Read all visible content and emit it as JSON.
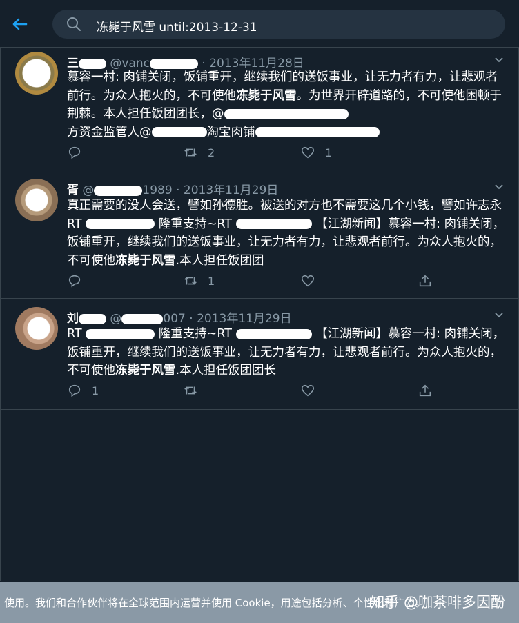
{
  "search": {
    "query": "冻毙于风雪 until:2013-12-31"
  },
  "tweets": [
    {
      "name": "三",
      "handle": "@vanc",
      "date": "· 2013年11月28日",
      "text_1": "慕容一村: 肉铺关闭，饭铺重开，继续我们的送饭事业，让无力者有力，让悲观者前行。为众人抱火的，不可使他",
      "text_bold": "冻毙于风雪",
      "text_2": "。为世界开辟道路的，不可使他困顿于荆棘。本人担任饭团团长，@",
      "text_3": "方资金监管人@",
      "text_4": "淘宝肉铺",
      "reply_count": "",
      "retweet_count": "2",
      "like_count": "1"
    },
    {
      "name": "胥",
      "handle": "@",
      "handle_tail": "1989",
      "date": "· 2013年11月29日",
      "line_1": "真正需要的没人会送，譬如孙德胜。被送的对方也不需要这几个小钱，譬如许志永RT",
      "rt_mid": "隆重支持~RT",
      "tag": "【江湖新闻】慕容一村: 肉铺关闭，饭铺重开，继续我们的送饭事业，让无力者有力，让悲观者前行。为众人抱火的，不可使他",
      "text_bold": "冻毙于风雪",
      "text_end": ".本人担任饭团团",
      "reply_count": "",
      "retweet_count": "1",
      "like_count": ""
    },
    {
      "name": "刘",
      "handle": "@",
      "handle_tail": "007",
      "date": "· 2013年11月29日",
      "rt": "RT",
      "rt_mid": "隆重支持~RT",
      "tag": "【江湖新闻】慕容一村: 肉铺关闭，饭铺重开，继续我们的送饭事业，让无力者有力，让悲观者前行。为众人抱火的，不可使他",
      "text_bold": "冻毙于风雪",
      "text_end": ".本人担任饭团团长",
      "reply_count": "1",
      "retweet_count": "",
      "like_count": ""
    }
  ],
  "cookie": {
    "text": "使用。我们和合作伙伴将在全球范围内运营并使用 Cookie，用途包括分析、个性化和广告。",
    "watermark": "知乎 @咖茶啡多因酚"
  },
  "colors": {
    "background": "#15202b",
    "accent": "#1da1f2",
    "muted": "#8899a6",
    "border": "#38444d"
  },
  "icons": [
    "back-arrow-icon",
    "search-icon",
    "chevron-down-icon",
    "reply-icon",
    "retweet-icon",
    "like-icon",
    "share-icon"
  ]
}
